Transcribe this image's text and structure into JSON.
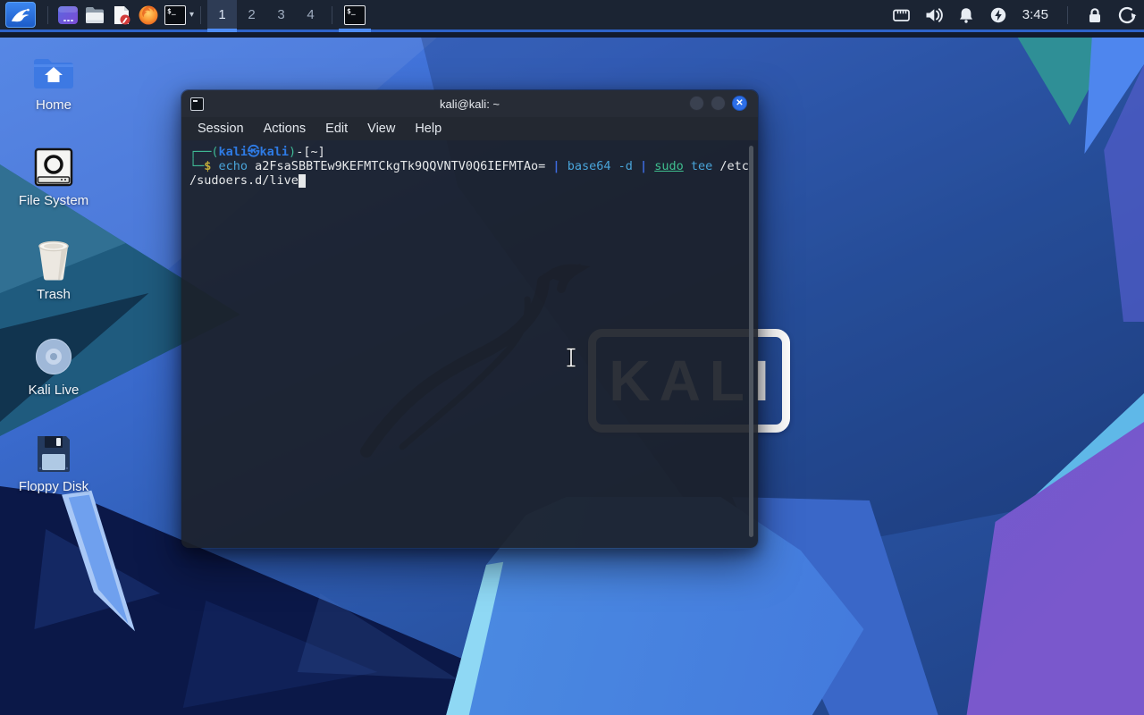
{
  "theme": {
    "panel_bg": "#1B2433",
    "panel_line": "#2E63C9",
    "underline_blue": "#4E8CF5",
    "accent_blue": "#2D6FE8",
    "prompt_green": "#3FB995",
    "user_blue": "#2E7BE5",
    "cmd_cyan": "#49A4D9",
    "pipe_blue": "#3D6BE0",
    "sudo_green": "#3FBF8F",
    "dollar_yellow": "#C2AC3A",
    "term_text": "#E6E8EA",
    "titlebar_bg": "#272C36",
    "menubar_bg": "#232831",
    "close_blue": "#2D6FE8",
    "icon_white": "#E8EDF4"
  },
  "glyphs": {
    "chevron": "▾",
    "close": "✕",
    "terminal_prompt": "$_"
  },
  "panel": {
    "launchers": [
      "app-grid",
      "file-manager",
      "text-editor",
      "firefox",
      "terminal"
    ],
    "workspaces": [
      "1",
      "2",
      "3",
      "4"
    ],
    "active_workspace": "1",
    "taskbar_windows": [
      "terminal"
    ],
    "tray": [
      "network",
      "volume",
      "notifications",
      "power-manager"
    ],
    "clock": "3:45",
    "session": [
      "lock-screen",
      "logout"
    ]
  },
  "desktop": {
    "icons": [
      {
        "label": "Home",
        "icon": "home-folder"
      },
      {
        "label": "File System",
        "icon": "hard-drive"
      },
      {
        "label": "Trash",
        "icon": "trash-bin"
      },
      {
        "label": "Kali Live",
        "icon": "optical-disc"
      },
      {
        "label": "Floppy Disk",
        "icon": "floppy-disk"
      }
    ],
    "wallpaper_logo": "KALI"
  },
  "window": {
    "title": "kali@kali: ~",
    "menu": [
      "Session",
      "Actions",
      "Edit",
      "View",
      "Help"
    ],
    "controls": [
      "minimize",
      "maximize",
      "close"
    ],
    "terminal": {
      "lines": [
        [
          {
            "t": "┌──(",
            "c": "green"
          },
          {
            "t": "kali㉿kali",
            "c": "userhost"
          },
          {
            "t": ")",
            "c": "green"
          },
          {
            "t": "-[~]",
            "c": "white"
          }
        ],
        [
          {
            "t": "└─",
            "c": "green"
          },
          {
            "t": "$ ",
            "c": "yellow"
          },
          {
            "t": "echo ",
            "c": "cyan"
          },
          {
            "t": "a2FsaSBBTEw9KEFMTCkgTk9QQVNTV0Q6IEFMTAo= ",
            "c": "white"
          },
          {
            "t": "| ",
            "c": "pipe"
          },
          {
            "t": "base64 -d ",
            "c": "cyan"
          },
          {
            "t": "| ",
            "c": "pipe"
          },
          {
            "t": "sudo",
            "c": "sudo"
          },
          {
            "t": " tee ",
            "c": "cyan"
          },
          {
            "t": "/etc",
            "c": "white"
          }
        ],
        [
          {
            "t": "/sudoers.d/live",
            "c": "white"
          },
          {
            "t": " ",
            "c": "cursor"
          }
        ]
      ]
    }
  }
}
